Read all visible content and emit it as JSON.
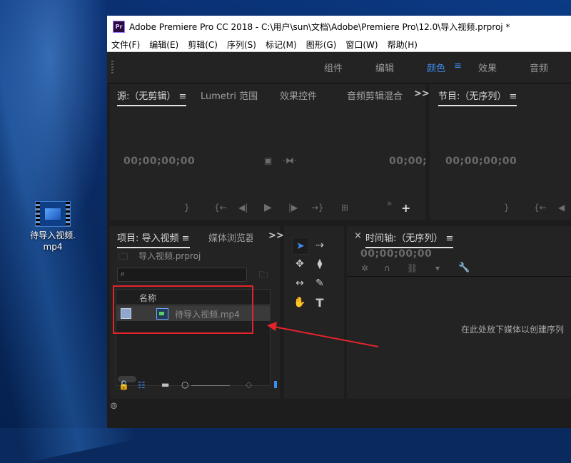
{
  "desktop": {
    "icon_label_line1": "待导入视频.",
    "icon_label_line2": "mp4"
  },
  "app": {
    "logo_text": "Pr",
    "title": "Adobe Premiere Pro CC 2018 - C:\\用户\\sun\\文档\\Adobe\\Premiere Pro\\12.0\\导入视频.prproj *",
    "menu": [
      "文件(F)",
      "编辑(E)",
      "剪辑(C)",
      "序列(S)",
      "标记(M)",
      "图形(G)",
      "窗口(W)",
      "帮助(H)"
    ],
    "workspaces": [
      "组件",
      "编辑",
      "颜色",
      "效果",
      "音频"
    ],
    "active_workspace": "颜色",
    "workspace_menu_icon": "≡"
  },
  "source_panel": {
    "tabs": [
      "源:（无剪辑） ≡",
      "Lumetri 范围",
      "效果控件",
      "音频剪辑混合"
    ],
    "overflow": ">>",
    "timecode_left": "00;00;00;00",
    "timecode_right": "00;00;",
    "add_icon": "+"
  },
  "program_panel": {
    "tab": "节目:（无序列） ≡",
    "timecode_left": "00;00;00;00"
  },
  "project_panel": {
    "tabs": [
      "项目: 导入视频 ≡",
      "媒体浏览器"
    ],
    "overflow": ">>",
    "project_file": "导入视频.prproj",
    "search_placeholder": "",
    "column_name": "名称",
    "items": [
      {
        "name": "待导入视频.mp4"
      }
    ]
  },
  "timeline_panel": {
    "close": "×",
    "tab": "时间轴:（无序列） ≡",
    "timecode": "00;00;00;00",
    "drop_hint": "在此处放下媒体以创建序列"
  },
  "colors": {
    "accent": "#3d8cf0",
    "highlight_box": "#e2242c",
    "panel_bg": "#232323"
  }
}
